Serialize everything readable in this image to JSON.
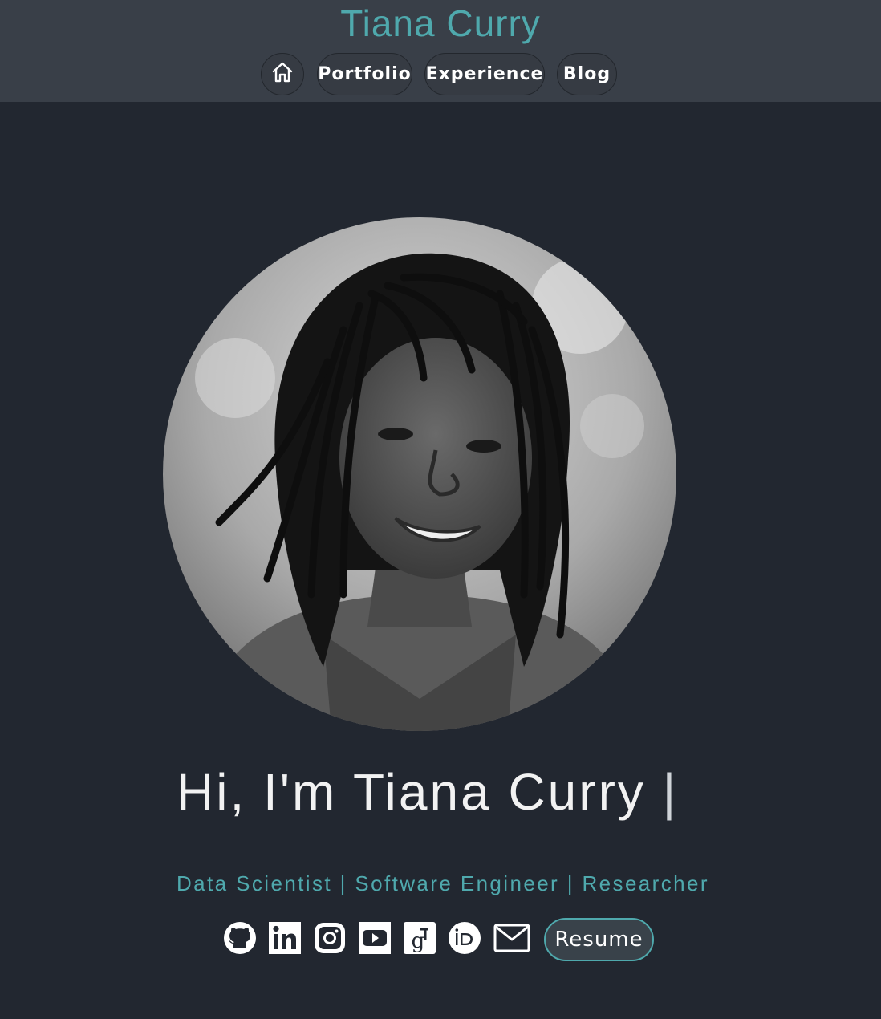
{
  "header": {
    "site_title": "Tiana Curry",
    "nav": {
      "home_icon": "home-icon",
      "portfolio": "Portfolio",
      "experience": "Experience",
      "blog": "Blog"
    }
  },
  "hero": {
    "greeting": "Hi, I'm Tiana Curry",
    "cursor": "|",
    "tagline": "Data Scientist | Software Engineer | Researcher",
    "profile_photo": "profile-photo"
  },
  "social": {
    "icons": [
      "github-icon",
      "linkedin-icon",
      "instagram-icon",
      "youtube-icon",
      "google-scholar-icon",
      "orcid-icon",
      "mail-icon"
    ],
    "resume_label": "Resume"
  },
  "colors": {
    "background": "#222730",
    "header": "#393f48",
    "accent": "#4fa9ad",
    "text": "#f2f2f2"
  }
}
